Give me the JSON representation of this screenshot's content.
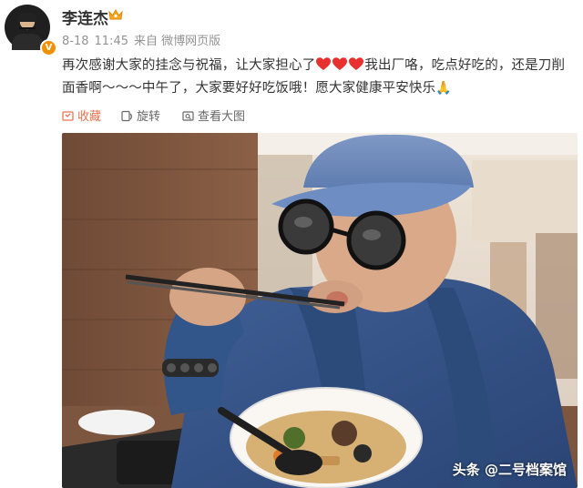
{
  "user": {
    "name": "李连杰",
    "avatar_icon": "user-avatar",
    "verified_icon": "verified-v-badge",
    "badge_icon": "crown-icon",
    "badge_color": "#f29100"
  },
  "meta": {
    "date": "8-18",
    "time": "11:45",
    "source": "来自 微博网页版"
  },
  "post": {
    "text_a": "再次感谢大家的挂念与祝福，让大家担心了",
    "text_b": "我出厂咯，吃点好吃的，还是刀削面香啊～～～中午了，大家要好好吃饭哦！愿大家健康平安快乐",
    "heart_color": "#e8312f",
    "emoji_pray": "🙏"
  },
  "actions": {
    "favorite": "收藏",
    "repost": "旋转",
    "view_large": "查看大图",
    "favorite_color": "#eb7350"
  },
  "photo": {
    "watermark": "头条 @二号档案馆"
  }
}
